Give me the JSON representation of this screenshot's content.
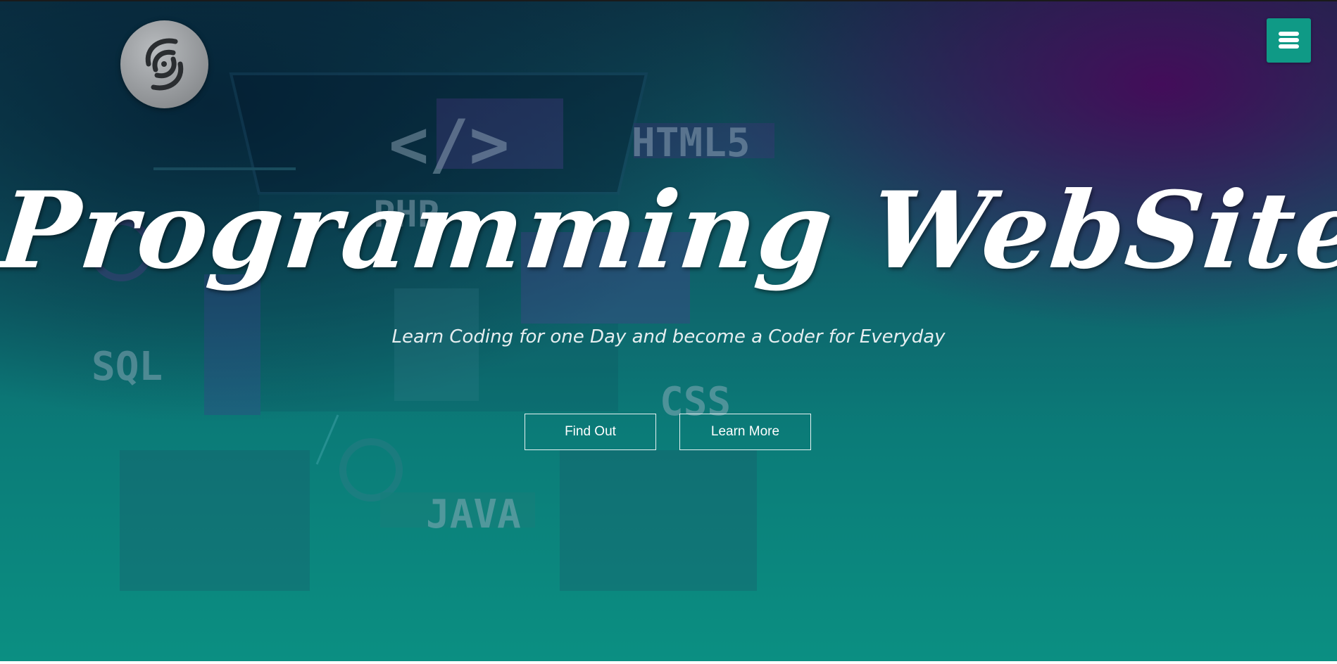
{
  "header": {
    "logo_icon": "swirl-logo-icon",
    "menu_icon": "hamburger-menu-icon",
    "menu_color": "#0f9a86"
  },
  "hero": {
    "title": "Programming WebSite",
    "subtitle": "Learn Coding for one Day and become a Coder for Everyday",
    "buttons": [
      {
        "label": "Find Out"
      },
      {
        "label": "Learn More"
      }
    ]
  },
  "background_art": {
    "labels": [
      "</>",
      "HTML5",
      "PHP",
      "SQL",
      "CSS",
      "JAVA"
    ]
  },
  "colors": {
    "accent": "#0f9a86",
    "gradient_top_right": "#46105a",
    "gradient_bottom": "#0b8f82"
  }
}
